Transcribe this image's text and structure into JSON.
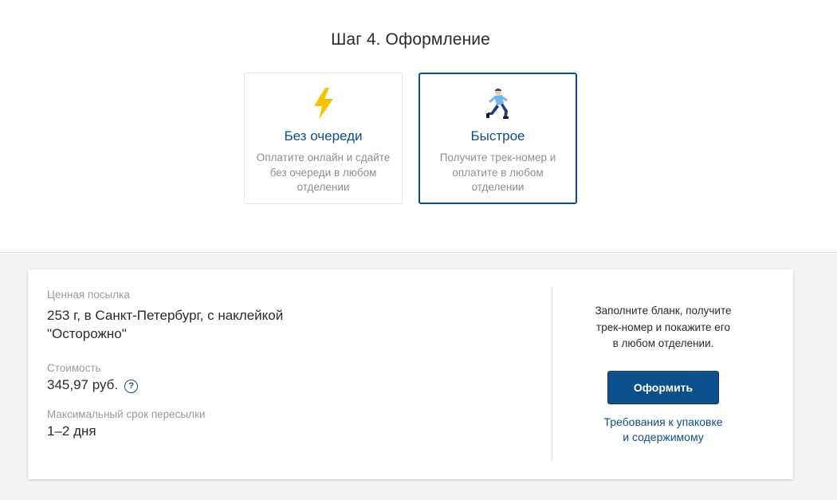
{
  "step": {
    "title": "Шаг 4. Оформление"
  },
  "options": [
    {
      "title": "Без очереди",
      "desc_lines": [
        "Оплатите онлайн и сдайте",
        "без очереди в любом",
        "отделении"
      ],
      "icon": "lightning-icon",
      "selected": false
    },
    {
      "title": "Быстрое",
      "desc_lines": [
        "Получите трек-номер и",
        "оплатите в любом",
        "отделении"
      ],
      "icon": "runner-icon",
      "selected": true
    }
  ],
  "summary": {
    "type_label": "Ценная посылка",
    "description_lines": [
      "253 г, в Санкт-Петербург, с наклейкой",
      "\"Осторожно\""
    ],
    "cost_label": "Стоимость",
    "cost_value": "345,97 руб.",
    "help_symbol": "?",
    "term_label": "Максимальный срок пересылки",
    "term_value": "1–2 дня"
  },
  "action": {
    "hint_lines": [
      "Заполните бланк, получите",
      "трек-номер и покажите его",
      "в любом отделении."
    ],
    "button_label": "Оформить",
    "requirements_lines": [
      "Требования к упаковке",
      "и содержимому"
    ]
  },
  "colors": {
    "accent": "#0b4f8c",
    "lightning": "#f5c400",
    "muted_text": "#9a9a9a",
    "background_bottom": "#f4f4f4"
  }
}
